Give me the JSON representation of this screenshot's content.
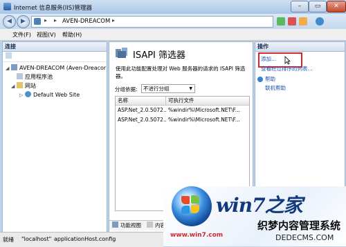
{
  "window": {
    "title": "Internet 信息服务(IIS)管理器"
  },
  "address": {
    "path": "AVEN-DREACOM",
    "separator": "▸"
  },
  "menu": {
    "items": [
      "文件(F)",
      "视图(V)",
      "帮助(H)"
    ]
  },
  "connections": {
    "header": "连接",
    "tree": [
      {
        "label": "AVEN-DREACOM (Aven-Dreacor",
        "level": 0
      },
      {
        "label": "应用程序池",
        "level": 1
      },
      {
        "label": "网站",
        "level": 1
      },
      {
        "label": "Default Web Site",
        "level": 2
      }
    ]
  },
  "feature": {
    "title": "ISAPI 筛选器",
    "description": "使用此功能配置处理对 Web 服务器的请求的 ISAPI 筛选器。",
    "groupby_label": "分组依据:",
    "groupby_value": "不进行分组",
    "columns": [
      "名称",
      "可执行文件"
    ],
    "rows": [
      [
        "ASP.Net_2.0.5072...",
        "%windir%\\Microsoft.NET\\F..."
      ],
      [
        "ASP.Net_2.0.5072...",
        "%windir%\\Microsoft.NET\\F..."
      ]
    ],
    "tabs": [
      "功能视图",
      "内容视"
    ]
  },
  "actions": {
    "header": "操作",
    "items": [
      "添加...",
      "查看经过排序的列表...",
      "帮助",
      "联机帮助"
    ]
  },
  "status": {
    "text": "就绪",
    "server": "\"localhost\"",
    "config": "applicationHost.config"
  },
  "watermark": {
    "title": "win7之家",
    "subtitle": "织梦内容管理系统",
    "url": "www.win7.com",
    "url2": "DEDECMS.COM"
  }
}
